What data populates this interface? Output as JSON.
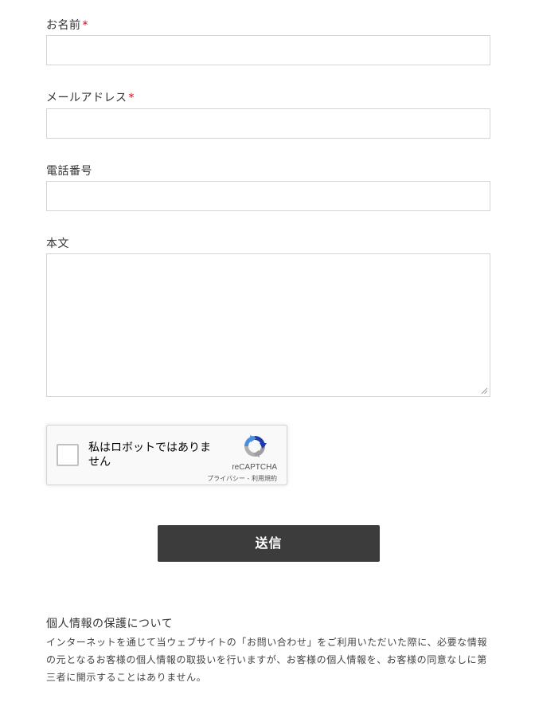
{
  "form": {
    "name_label": "お名前",
    "email_label": "メールアドレス",
    "phone_label": "電話番号",
    "body_label": "本文",
    "required_mark": "*",
    "name_value": "",
    "email_value": "",
    "phone_value": "",
    "body_value": ""
  },
  "recaptcha": {
    "label": "私はロボットではありません",
    "brand": "reCAPTCHA",
    "privacy_link": "プライバシー",
    "separator": " - ",
    "terms_link": "利用規約",
    "checked": false,
    "icon": "recaptcha-logo-icon"
  },
  "submit": {
    "label": "送信"
  },
  "privacy": {
    "title": "個人情報の保護について",
    "text": "インターネットを通じて当ウェブサイトの「お問い合わせ」をご利用いただいた際に、必要な情報の元となるお客様の個人情報の取扱いを行いますが、お客様の個人情報を、お客様の同意なしに第三者に開示することはありません。"
  },
  "colors": {
    "required": "#e60012",
    "button_bg": "#3c3c3c",
    "border": "#d4d4d4"
  }
}
